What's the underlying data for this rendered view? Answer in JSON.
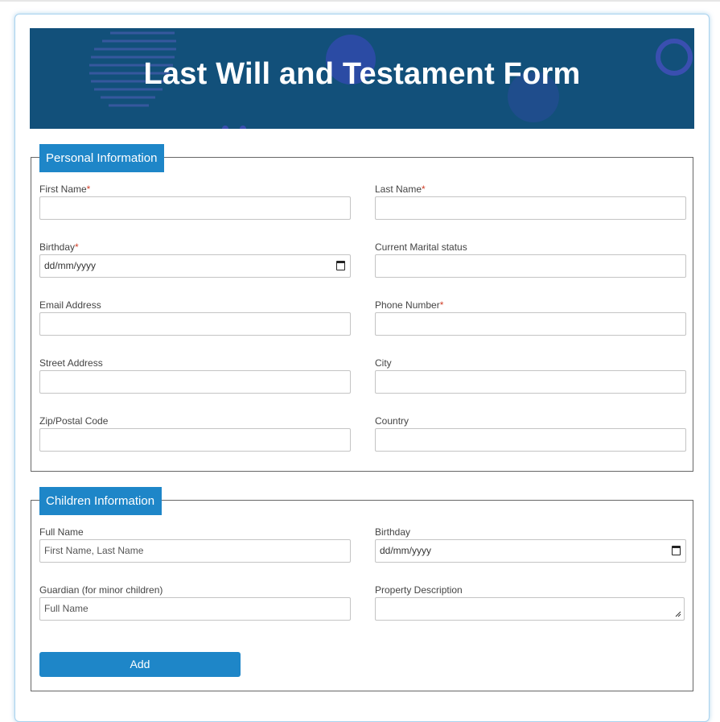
{
  "form": {
    "title": "Last Will and Testament Form"
  },
  "personal": {
    "legend": "Personal Information",
    "first_name": {
      "label": "First Name",
      "required": "*"
    },
    "last_name": {
      "label": "Last Name",
      "required": "*"
    },
    "birthday": {
      "label": "Birthday",
      "required": "*",
      "placeholder": "dd/mm/yyyy"
    },
    "marital": {
      "label": "Current Marital status"
    },
    "email": {
      "label": "Email Address"
    },
    "phone": {
      "label": "Phone Number",
      "required": "*"
    },
    "street": {
      "label": "Street Address"
    },
    "city": {
      "label": "City"
    },
    "zip": {
      "label": "Zip/Postal Code"
    },
    "country": {
      "label": "Country"
    }
  },
  "children": {
    "legend": "Children Information",
    "full_name": {
      "label": "Full Name",
      "placeholder": "First Name, Last Name"
    },
    "birthday": {
      "label": "Birthday",
      "placeholder": "dd/mm/yyyy"
    },
    "guardian": {
      "label": "Guardian (for minor children)",
      "placeholder": "Full Name"
    },
    "property": {
      "label": "Property Description"
    },
    "add_button": "Add"
  },
  "colors": {
    "banner": "#12507a",
    "accent": "#1e86c8",
    "required": "#d0402a"
  }
}
